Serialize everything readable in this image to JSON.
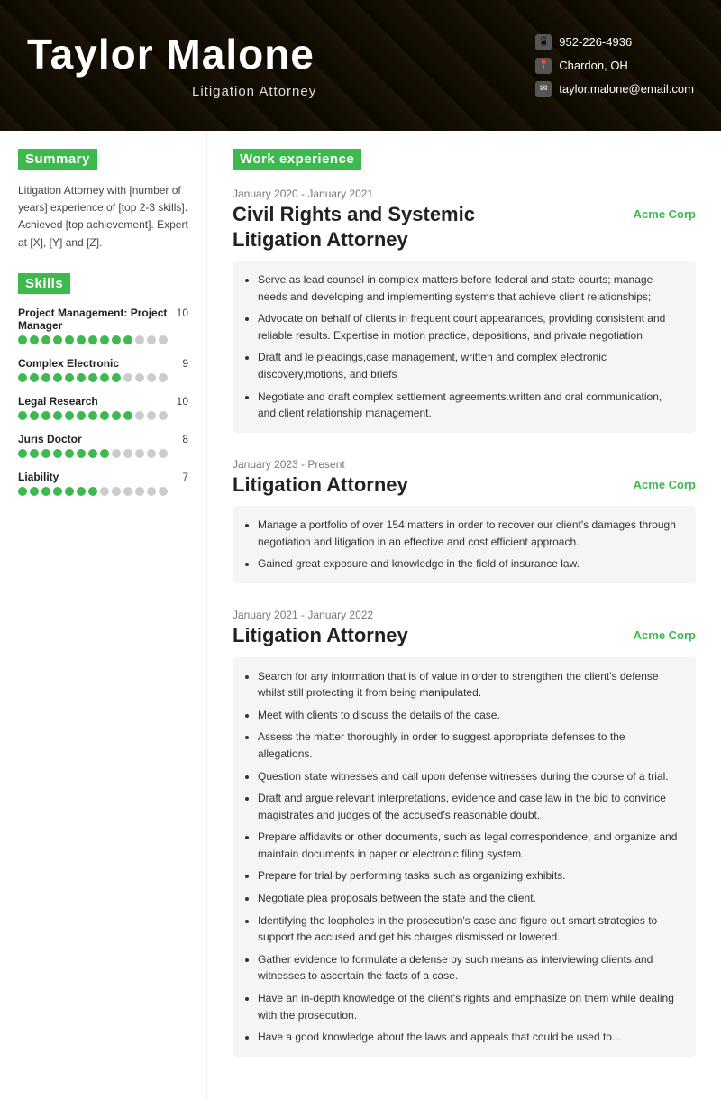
{
  "header": {
    "name": "Taylor Malone",
    "title": "Litigation Attorney",
    "phone": "952-226-4936",
    "location": "Chardon, OH",
    "email": "taylor.malone@email.com"
  },
  "sidebar": {
    "summary_label": "Summary",
    "summary_text": "Litigation Attorney with [number of years] experience of [top 2-3 skills]. Achieved [top achievement]. Expert at [X], [Y] and [Z].",
    "skills_label": "Skills",
    "skills": [
      {
        "name": "Project Management: Project Manager",
        "score": 10,
        "filled": 10,
        "total": 13
      },
      {
        "name": "Complex Electronic",
        "score": 9,
        "filled": 9,
        "total": 13
      },
      {
        "name": "Legal Research",
        "score": 10,
        "filled": 10,
        "total": 13
      },
      {
        "name": "Juris Doctor",
        "score": 8,
        "filled": 8,
        "total": 13
      },
      {
        "name": "Liability",
        "score": 7,
        "filled": 7,
        "total": 13
      }
    ]
  },
  "work": {
    "section_label": "Work experience",
    "jobs": [
      {
        "date": "January 2020 - January 2021",
        "title": "Civil Rights and Systemic\nLitigation Attorney",
        "company": "Acme Corp",
        "bullets": [
          "Serve as lead counsel in complex matters before federal and state courts; manage needs and developing and implementing systems that achieve client relationships;",
          "Advocate on behalf of clients in frequent court appearances, providing consistent and reliable results. Expertise in motion practice, depositions, and private negotiation",
          "Draft and le pleadings,case management, written and complex electronic discovery,motions, and briefs",
          "Negotiate and draft complex settlement agreements.written and oral communication, and client relationship management."
        ]
      },
      {
        "date": "January 2023 - Present",
        "title": "Litigation Attorney",
        "company": "Acme Corp",
        "bullets": [
          "Manage a portfolio of over 154 matters in order to recover our client's damages through negotiation and litigation in an effective and cost efficient approach.",
          "Gained great exposure and knowledge in the  field of insurance law."
        ]
      },
      {
        "date": "January 2021 - January 2022",
        "title": "Litigation Attorney",
        "company": "Acme Corp",
        "bullets": [
          "Search for any information that is of value in order to strengthen the client's defense whilst still protecting it from being manipulated.",
          "Meet with clients to discuss the details of the case.",
          "Assess the matter thoroughly in order to suggest appropriate defenses to the allegations.",
          "Question state witnesses and call upon defense witnesses during the course of a trial.",
          "Draft and argue relevant interpretations, evidence and case law in the bid to convince magistrates and judges of the accused's reasonable doubt.",
          "Prepare affidavits or other documents, such as legal correspondence, and organize and maintain documents in paper or electronic filing system.",
          "Prepare for trial by performing tasks such as organizing exhibits.",
          "Negotiate plea proposals between the state and the client.",
          "Identifying the loopholes in the prosecution's case and figure out smart strategies to support the accused and get his charges dismissed or lowered.",
          "Gather evidence to formulate a defense by such means as interviewing clients and witnesses to ascertain the facts of a case.",
          "Have an in-depth knowledge of the client's rights and emphasize on them while dealing with the prosecution.",
          "Have a good knowledge about the laws and appeals that could be used to..."
        ]
      }
    ]
  }
}
